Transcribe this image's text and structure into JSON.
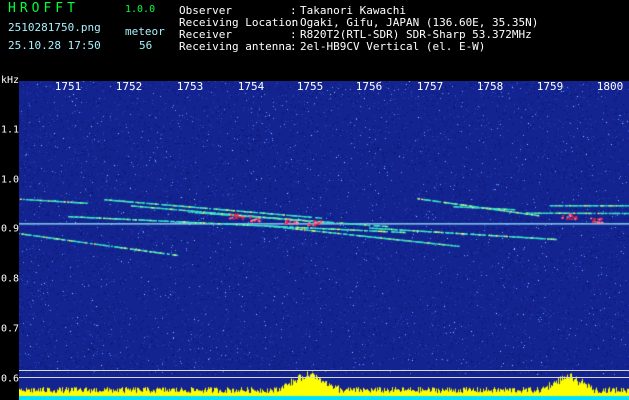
{
  "header": {
    "app_title": "HROFFT",
    "app_version": "1.0.0",
    "file_name": "2510281750.png",
    "timestamp": "25.10.28 17:50",
    "detection_type": "meteor",
    "detection_count": "56",
    "info": [
      {
        "label": "Observer",
        "value": "Takanori Kawachi"
      },
      {
        "label": "Receiving Location",
        "value": "Ogaki, Gifu, JAPAN (136.60E, 35.35N)"
      },
      {
        "label": "Receiver",
        "value": "R820T2(RTL-SDR) SDR-Sharp 53.372MHz"
      },
      {
        "label": "Receiving antenna",
        "value": "2el-HB9CV Vertical (el. E-W)"
      }
    ]
  },
  "time_axis": {
    "ticks": [
      "1751",
      "1752",
      "1753",
      "1754",
      "1755",
      "1756",
      "1757",
      "1758",
      "1759",
      "1800"
    ]
  },
  "freq_axis": {
    "unit": "kHz",
    "ticks": [
      "1.1",
      "1.0",
      "0.9",
      "0.8",
      "0.7",
      "0.6"
    ]
  },
  "colors": {
    "background": "#13238f",
    "noise_highlight": "#5aa0ff",
    "trail": "#38e6c8",
    "trail_hot": "#ff2040",
    "carrier": "#9af0ff",
    "power_bars": "#ffff00",
    "power_base": "#00e0ff",
    "header_green": "#00ff3c"
  },
  "trails": [
    {
      "t0": 1750.2,
      "f0": 0.963,
      "t1": 1751.3,
      "f1": 0.955
    },
    {
      "t0": 1751.6,
      "f0": 0.962,
      "t1": 1755.2,
      "f1": 0.925
    },
    {
      "t0": 1752.0,
      "f0": 0.95,
      "t1": 1755.1,
      "f1": 0.918
    },
    {
      "t0": 1753.0,
      "f0": 0.937,
      "t1": 1756.3,
      "f1": 0.908
    },
    {
      "t0": 1751.0,
      "f0": 0.928,
      "t1": 1756.6,
      "f1": 0.896
    },
    {
      "t0": 1754.4,
      "f0": 0.908,
      "t1": 1757.5,
      "f1": 0.868
    },
    {
      "t0": 1750.1,
      "f0": 0.895,
      "t1": 1752.8,
      "f1": 0.85
    },
    {
      "t0": 1756.0,
      "f0": 0.905,
      "t1": 1759.1,
      "f1": 0.882
    },
    {
      "t0": 1756.8,
      "f0": 0.964,
      "t1": 1758.8,
      "f1": 0.93
    },
    {
      "t0": 1758.6,
      "f0": 0.935,
      "t1": 1800.2,
      "f1": 0.92
    },
    {
      "t0": 1757.4,
      "f0": 0.948,
      "t1": 1758.4,
      "f1": 0.942
    },
    {
      "t0": 1759.0,
      "f0": 0.95,
      "t1": 1800.2,
      "f1": 0.948
    }
  ],
  "hot_spots": [
    {
      "t": 1754.7,
      "f": 0.918
    },
    {
      "t": 1755.1,
      "f": 0.915
    },
    {
      "t": 1754.1,
      "f": 0.922
    },
    {
      "t": 1759.3,
      "f": 0.928
    },
    {
      "t": 1759.8,
      "f": 0.92
    },
    {
      "t": 1753.8,
      "f": 0.928
    }
  ]
}
